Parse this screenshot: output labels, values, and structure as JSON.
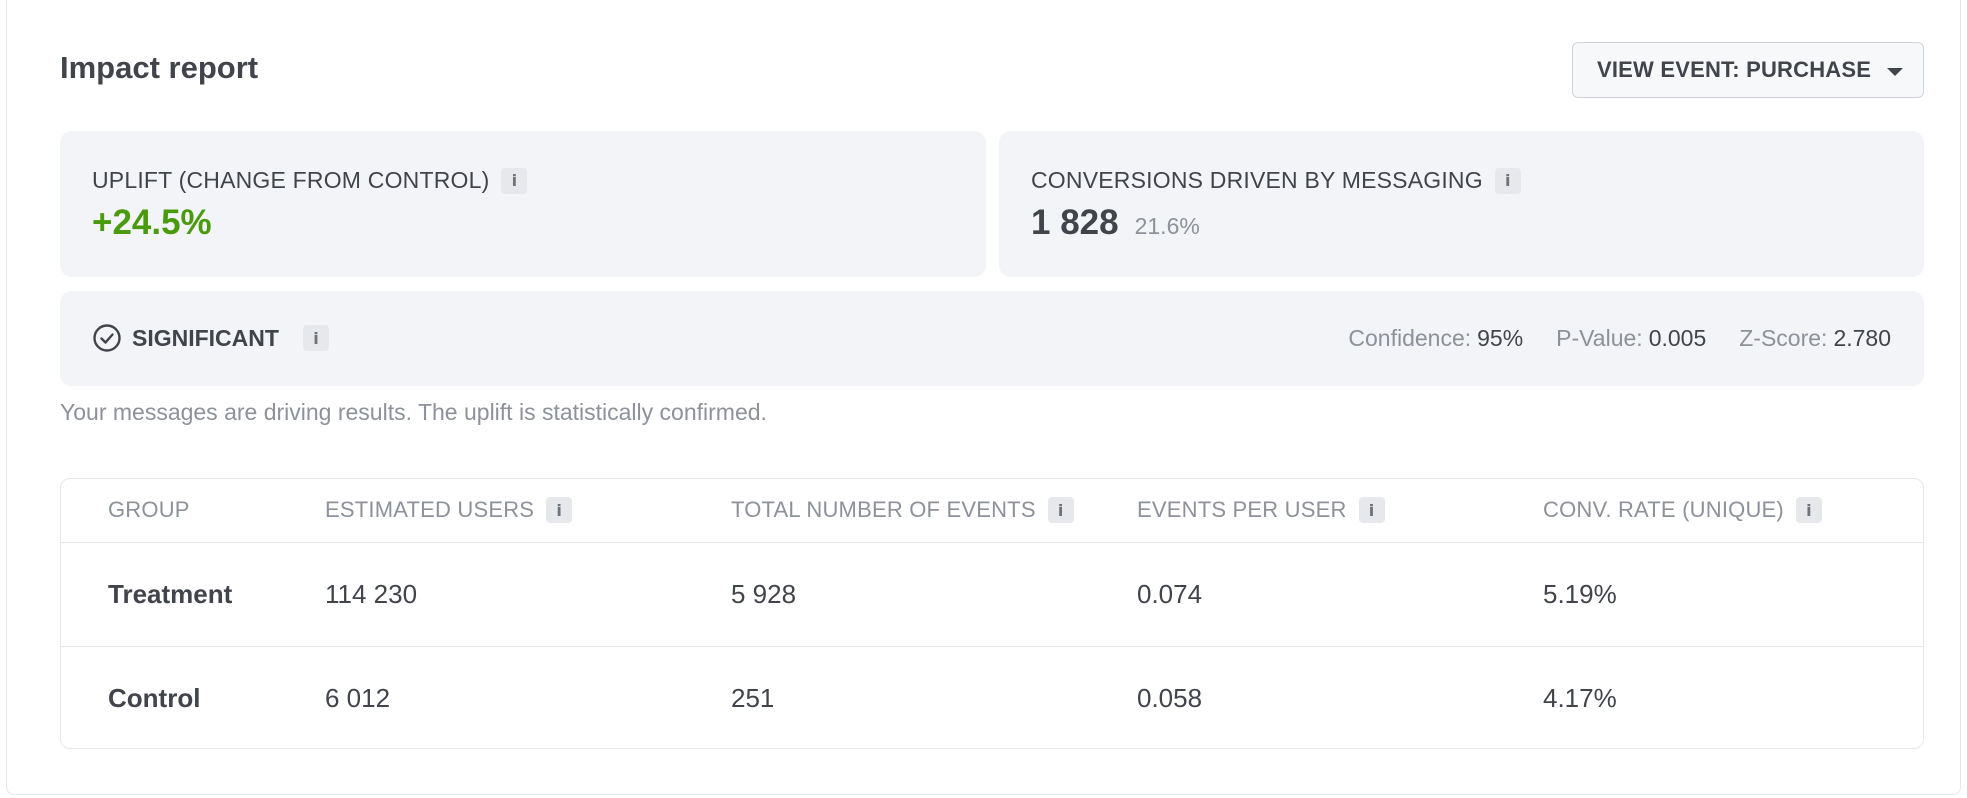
{
  "header": {
    "title": "Impact report",
    "view_event_label": "VIEW EVENT: PURCHASE"
  },
  "uplift": {
    "label": "UPLIFT (CHANGE FROM CONTROL)",
    "value": "+24.5%"
  },
  "conversions": {
    "label": "CONVERSIONS DRIVEN BY MESSAGING",
    "value": "1 828",
    "percent": "21.6%"
  },
  "significance": {
    "label": "SIGNIFICANT",
    "confidence_label": "Confidence:",
    "confidence_value": "95%",
    "pvalue_label": "P-Value:",
    "pvalue_value": "0.005",
    "zscore_label": "Z-Score:",
    "zscore_value": "2.780"
  },
  "message": "Your messages are driving results. The uplift is statistically confirmed.",
  "table": {
    "headers": [
      "GROUP",
      "ESTIMATED USERS",
      "TOTAL NUMBER OF EVENTS",
      "EVENTS PER USER",
      "CONV. RATE (UNIQUE)"
    ],
    "rows": [
      [
        "Treatment",
        "114 230",
        "5 928",
        "0.074",
        "5.19%"
      ],
      [
        "Control",
        "6 012",
        "251",
        "0.058",
        "4.17%"
      ]
    ]
  },
  "icons": {
    "info": "info-icon",
    "check": "check-circle-icon",
    "caret": "caret-down-icon"
  },
  "colors": {
    "positive": "#4a9a0e",
    "card_bg": "#f3f4f7"
  }
}
